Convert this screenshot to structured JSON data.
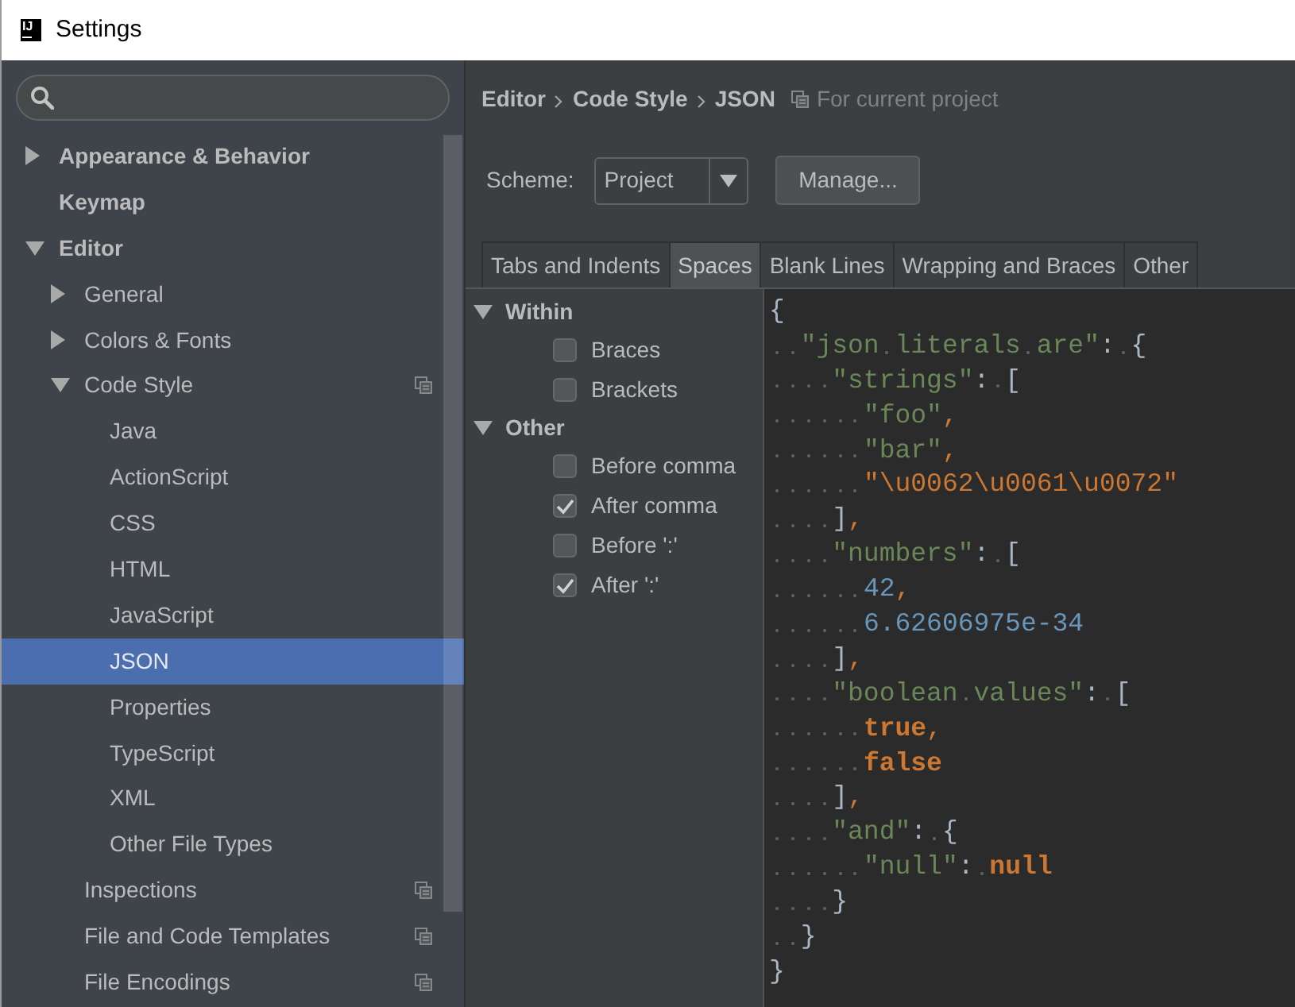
{
  "window": {
    "title": "Settings",
    "logo_text": "IJ"
  },
  "sidebar": {
    "items": [
      {
        "label": "Appearance & Behavior",
        "expanded": false,
        "selected": false,
        "project_scoped": false
      },
      {
        "label": "Keymap",
        "selected": false,
        "project_scoped": false
      },
      {
        "label": "Editor",
        "expanded": true,
        "selected": false,
        "project_scoped": false,
        "children": [
          {
            "label": "General",
            "expanded": false,
            "selected": false,
            "project_scoped": false
          },
          {
            "label": "Colors & Fonts",
            "expanded": false,
            "selected": false,
            "project_scoped": false
          },
          {
            "label": "Code Style",
            "expanded": true,
            "selected": false,
            "project_scoped": true,
            "children": [
              {
                "label": "Java",
                "selected": false,
                "project_scoped": false
              },
              {
                "label": "ActionScript",
                "selected": false,
                "project_scoped": false
              },
              {
                "label": "CSS",
                "selected": false,
                "project_scoped": false
              },
              {
                "label": "HTML",
                "selected": false,
                "project_scoped": false
              },
              {
                "label": "JavaScript",
                "selected": false,
                "project_scoped": false
              },
              {
                "label": "JSON",
                "selected": true,
                "project_scoped": false
              },
              {
                "label": "Properties",
                "selected": false,
                "project_scoped": false
              },
              {
                "label": "TypeScript",
                "selected": false,
                "project_scoped": false
              },
              {
                "label": "XML",
                "selected": false,
                "project_scoped": false
              },
              {
                "label": "Other File Types",
                "selected": false,
                "project_scoped": false
              }
            ]
          },
          {
            "label": "Inspections",
            "selected": false,
            "project_scoped": true
          },
          {
            "label": "File and Code Templates",
            "selected": false,
            "project_scoped": true
          },
          {
            "label": "File Encodings",
            "selected": false,
            "project_scoped": true
          }
        ]
      }
    ]
  },
  "breadcrumb": {
    "items": [
      "Editor",
      "Code Style",
      "JSON"
    ],
    "scope": "For current project"
  },
  "scheme": {
    "label": "Scheme:",
    "value": "Project"
  },
  "manage_button": "Manage...",
  "tabs": [
    {
      "label": "Tabs and Indents",
      "selected": false
    },
    {
      "label": "Spaces",
      "selected": true
    },
    {
      "label": "Blank Lines",
      "selected": false
    },
    {
      "label": "Wrapping and Braces",
      "selected": false
    },
    {
      "label": "Other",
      "selected": false
    }
  ],
  "options": [
    {
      "label": "Within",
      "expanded": true,
      "children": [
        {
          "label": "Braces",
          "checked": false
        },
        {
          "label": "Brackets",
          "checked": false
        }
      ]
    },
    {
      "label": "Other",
      "expanded": true,
      "children": [
        {
          "label": "Before comma",
          "checked": false
        },
        {
          "label": "After comma",
          "checked": true
        },
        {
          "label": "Before ':'",
          "checked": false
        },
        {
          "label": "After ':'",
          "checked": true
        }
      ]
    }
  ],
  "preview": {
    "lines": [
      [
        {
          "kind": "punct",
          "text": "{"
        }
      ],
      [
        {
          "kind": "key",
          "text": "  \"json literals are\""
        },
        {
          "kind": "punct",
          "text": ": {"
        }
      ],
      [
        {
          "kind": "key",
          "text": "    \"strings\""
        },
        {
          "kind": "punct",
          "text": ": ["
        }
      ],
      [
        {
          "kind": "string",
          "text": "      \"foo\""
        },
        {
          "kind": "comma",
          "text": ","
        }
      ],
      [
        {
          "kind": "string",
          "text": "      \"bar\""
        },
        {
          "kind": "comma",
          "text": ","
        }
      ],
      [
        {
          "kind": "escape",
          "text": "      \"\\u0062\\u0061\\u0072\""
        }
      ],
      [
        {
          "kind": "punct",
          "text": "    ]"
        },
        {
          "kind": "comma",
          "text": ","
        }
      ],
      [
        {
          "kind": "key",
          "text": "    \"numbers\""
        },
        {
          "kind": "punct",
          "text": ": ["
        }
      ],
      [
        {
          "kind": "number",
          "text": "      42"
        },
        {
          "kind": "comma",
          "text": ","
        }
      ],
      [
        {
          "kind": "number",
          "text": "      6.62606975e-34"
        }
      ],
      [
        {
          "kind": "punct",
          "text": "    ]"
        },
        {
          "kind": "comma",
          "text": ","
        }
      ],
      [
        {
          "kind": "key",
          "text": "    \"boolean values\""
        },
        {
          "kind": "punct",
          "text": ": ["
        }
      ],
      [
        {
          "kind": "keyword",
          "text": "      true"
        },
        {
          "kind": "comma",
          "text": ","
        }
      ],
      [
        {
          "kind": "keyword",
          "text": "      false"
        }
      ],
      [
        {
          "kind": "punct",
          "text": "    ]"
        },
        {
          "kind": "comma",
          "text": ","
        }
      ],
      [
        {
          "kind": "key",
          "text": "    \"and\""
        },
        {
          "kind": "punct",
          "text": ": {"
        }
      ],
      [
        {
          "kind": "string",
          "text": "      \"null\""
        },
        {
          "kind": "punct",
          "text": ": "
        },
        {
          "kind": "keyword",
          "text": "null"
        }
      ],
      [
        {
          "kind": "punct",
          "text": "    }"
        }
      ],
      [
        {
          "kind": "punct",
          "text": "  }"
        }
      ],
      [
        {
          "kind": "punct",
          "text": "}"
        }
      ]
    ]
  }
}
